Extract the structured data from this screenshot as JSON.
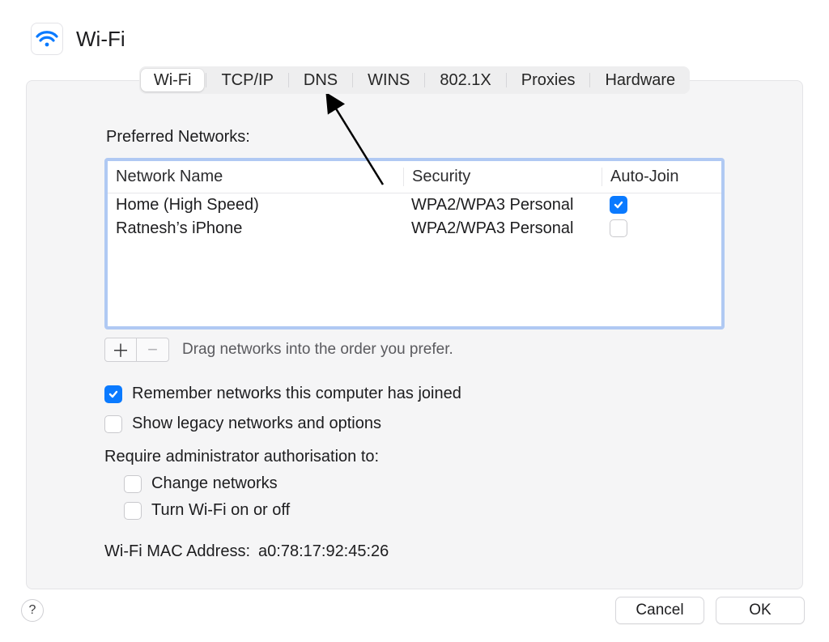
{
  "header": {
    "title": "Wi-Fi"
  },
  "tabs": {
    "items": [
      "Wi-Fi",
      "TCP/IP",
      "DNS",
      "WINS",
      "802.1X",
      "Proxies",
      "Hardware"
    ],
    "active_index": 0
  },
  "preferred": {
    "label": "Preferred Networks:",
    "columns": {
      "name": "Network Name",
      "security": "Security",
      "autojoin": "Auto-Join"
    },
    "rows": [
      {
        "name": "Home (High Speed)",
        "security": "WPA2/WPA3 Personal",
        "autojoin": true
      },
      {
        "name": "Ratnesh’s iPhone",
        "security": "WPA2/WPA3 Personal",
        "autojoin": false
      }
    ],
    "hint": "Drag networks into the order you prefer."
  },
  "options": {
    "remember": {
      "label": "Remember networks this computer has joined",
      "checked": true
    },
    "legacy": {
      "label": "Show legacy networks and options",
      "checked": false
    },
    "auth_label": "Require administrator authorisation to:",
    "auth_change": {
      "label": "Change networks",
      "checked": false
    },
    "auth_toggle": {
      "label": "Turn Wi-Fi on or off",
      "checked": false
    }
  },
  "mac": {
    "label": "Wi-Fi MAC Address:",
    "value": "a0:78:17:92:45:26"
  },
  "footer": {
    "help": "?",
    "cancel": "Cancel",
    "ok": "OK"
  },
  "icons": {
    "plus": "＋",
    "minus": "−"
  }
}
